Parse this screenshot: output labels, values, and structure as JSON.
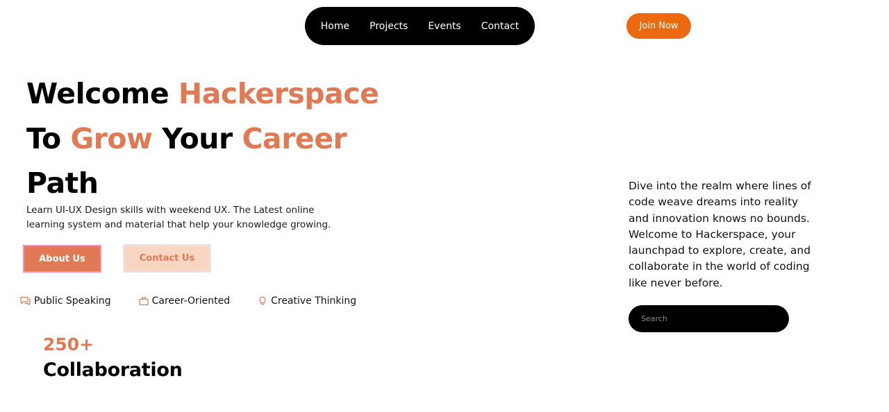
{
  "nav": {
    "items": [
      {
        "label": "Home"
      },
      {
        "label": "Projects"
      },
      {
        "label": "Events"
      },
      {
        "label": "Contact"
      }
    ],
    "join_label": "Join Now"
  },
  "hero": {
    "line1": {
      "plain": "Welcome ",
      "accent": "Hackerspace"
    },
    "line2": {
      "plain1": "To ",
      "accent1": "Grow",
      "plain2": " Your ",
      "accent2": "Career"
    },
    "line3": {
      "plain": "Path"
    },
    "subtitle": "Learn UI-UX Design skills with weekend UX. The Latest online learning system and material that help your knowledge growing.",
    "about_label": "About Us",
    "contact_label": "Contact Us"
  },
  "features": [
    {
      "icon": "speech-bubble-icon",
      "label": "Public Speaking"
    },
    {
      "icon": "briefcase-icon",
      "label": "Career-Oriented"
    },
    {
      "icon": "lightbulb-icon",
      "label": "Creative Thinking"
    }
  ],
  "stats": {
    "number": "250+",
    "label": "Collaboration"
  },
  "intro": {
    "text": "Dive into the realm where lines of code weave dreams into reality and innovation knows no bounds. Welcome to Hackerspace, your launchpad to explore, create, and collaborate in the world of coding like never before."
  },
  "search": {
    "placeholder": "Search",
    "value": ""
  },
  "colors": {
    "accent": "#e07a55",
    "join_button": "#ec6a0f",
    "nav_bg": "#000000",
    "contact_button_bg": "#f8d6c2"
  }
}
